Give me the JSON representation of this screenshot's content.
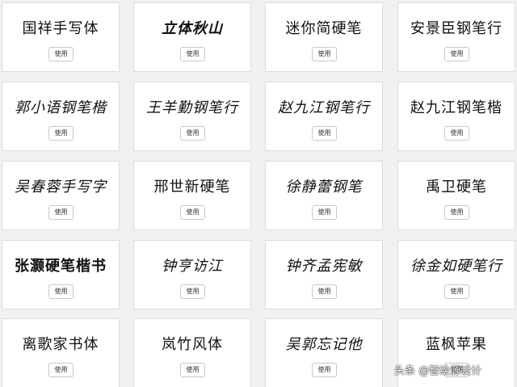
{
  "fonts": [
    {
      "name": "国祥手写体",
      "button": "使用"
    },
    {
      "name": "立体秋山",
      "button": "使用"
    },
    {
      "name": "迷你简硬笔",
      "button": "使用"
    },
    {
      "name": "安景臣钢笔行",
      "button": "使用"
    },
    {
      "name": "郭小语钢笔楷",
      "button": "使用"
    },
    {
      "name": "王羊勤钢笔行",
      "button": "使用"
    },
    {
      "name": "赵九江钢笔行",
      "button": "使用"
    },
    {
      "name": "赵九江钢笔楷",
      "button": "使用"
    },
    {
      "name": "吴春蓉手写字",
      "button": "使用"
    },
    {
      "name": "邢世新硬笔",
      "button": "使用"
    },
    {
      "name": "徐静蕾钢笔",
      "button": "使用"
    },
    {
      "name": "禹卫硬笔",
      "button": "使用"
    },
    {
      "name": "张灏硬笔楷书",
      "button": "使用"
    },
    {
      "name": "钟亨访江",
      "button": "使用"
    },
    {
      "name": "钟齐孟宪敏",
      "button": "使用"
    },
    {
      "name": "徐金如硬笔行",
      "button": "使用"
    },
    {
      "name": "离歌家书体",
      "button": "使用"
    },
    {
      "name": "岚竹风体",
      "button": "使用"
    },
    {
      "name": "吴郭忘记他",
      "button": "使用"
    },
    {
      "name": "蓝枫苹果",
      "button": "使用"
    }
  ],
  "watermark": "头条 @智绘源设计"
}
